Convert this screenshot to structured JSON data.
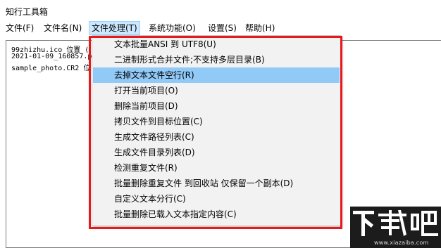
{
  "window": {
    "title": "知行工具箱"
  },
  "menubar": {
    "items": [
      {
        "label": "文件(F)"
      },
      {
        "label": "文件名(N)"
      },
      {
        "label": "文件处理(T)"
      },
      {
        "label": "系统功能(O)"
      },
      {
        "label": "设置(S)"
      },
      {
        "label": "帮助(H)"
      }
    ]
  },
  "editor": {
    "lines": [
      "99zhizhu.ico 位置 (",
      "2021-01-09_160857.p",
      "sample_photo.CR2 位"
    ]
  },
  "dropdown": {
    "items": [
      {
        "label": "文本批量ANSI 到 UTF8(U)"
      },
      {
        "label": "二进制形式合并文件;不支持多层目录(B)"
      },
      {
        "label": "去掉文本文件空行(R)"
      },
      {
        "label": "打开当前项目(O)"
      },
      {
        "label": "删除当前项目(D)"
      },
      {
        "label": "拷贝文件到目标位置(C)"
      },
      {
        "label": "生成文件路径列表(C)"
      },
      {
        "label": "生成文件目录列表(D)"
      },
      {
        "label": "检测重复文件(R)"
      },
      {
        "label": "批量删除重复文件 到回收站 仅保留一个副本(D)"
      },
      {
        "label": "自定义文本分行(C)"
      },
      {
        "label": "批量删除已载入文本指定内容(C)"
      }
    ],
    "highlighted_item": "去掉文本文件空行(R)"
  },
  "watermark": {
    "logo": "下载吧",
    "url": "www.xiazaiba.com"
  },
  "colors": {
    "highlight": "#91c9f7",
    "menu_active": "#cce8ff",
    "annotation_frame": "#e8191a",
    "dropdown_bg": "#f2f2f2"
  }
}
